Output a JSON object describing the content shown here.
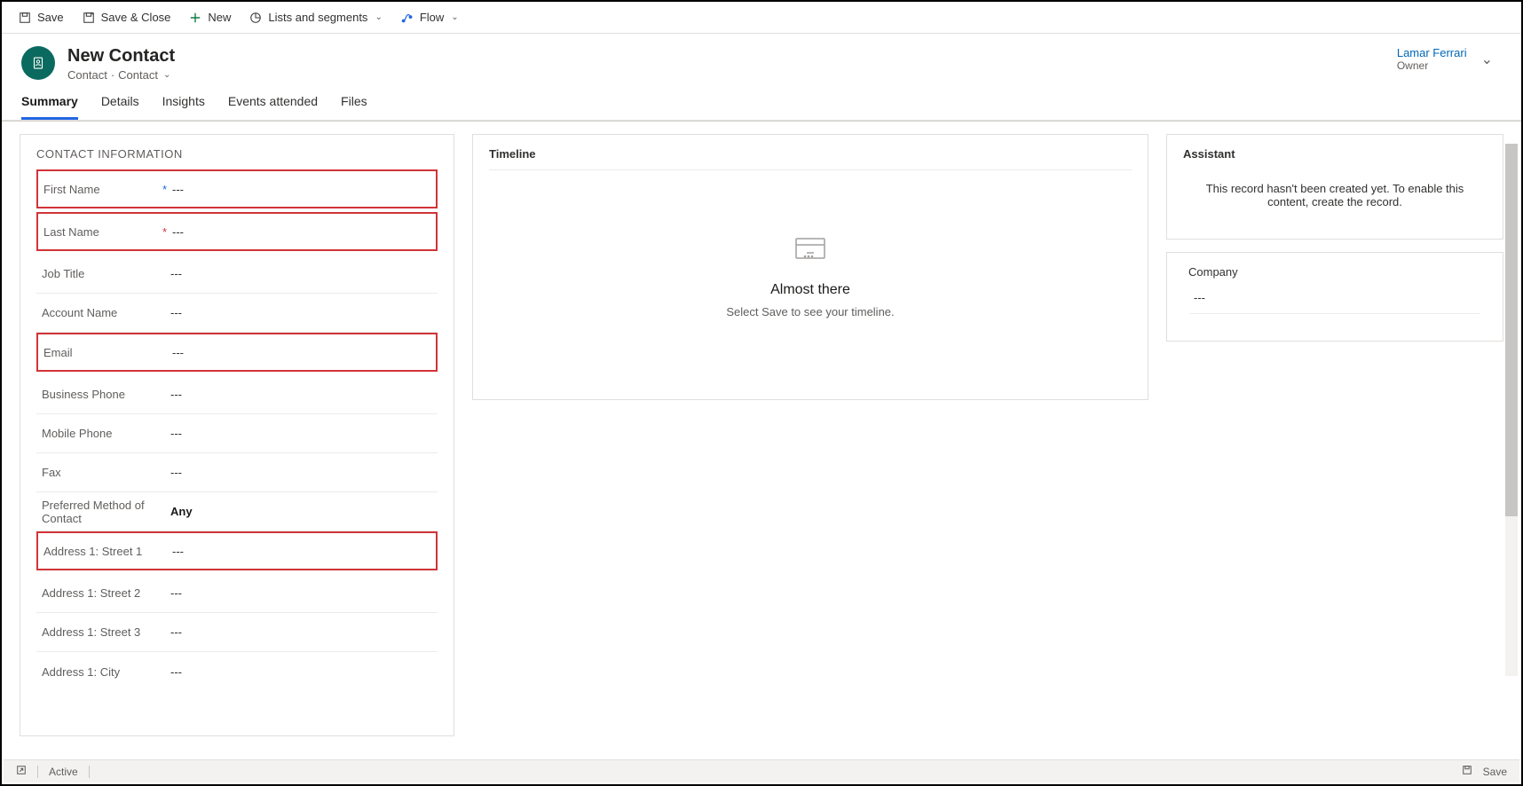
{
  "toolbar": {
    "save": "Save",
    "save_close": "Save & Close",
    "new": "New",
    "lists": "Lists and segments",
    "flow": "Flow"
  },
  "header": {
    "title": "New Contact",
    "entity": "Contact",
    "form": "Contact",
    "owner_name": "Lamar Ferrari",
    "owner_label": "Owner"
  },
  "tabs": [
    "Summary",
    "Details",
    "Insights",
    "Events attended",
    "Files"
  ],
  "contact_section_title": "CONTACT INFORMATION",
  "fields": {
    "first_name": {
      "label": "First Name",
      "value": "---"
    },
    "last_name": {
      "label": "Last Name",
      "value": "---"
    },
    "job_title": {
      "label": "Job Title",
      "value": "---"
    },
    "account_name": {
      "label": "Account Name",
      "value": "---"
    },
    "email": {
      "label": "Email",
      "value": "---"
    },
    "business_phone": {
      "label": "Business Phone",
      "value": "---"
    },
    "mobile_phone": {
      "label": "Mobile Phone",
      "value": "---"
    },
    "fax": {
      "label": "Fax",
      "value": "---"
    },
    "pref_contact": {
      "label": "Preferred Method of Contact",
      "value": "Any"
    },
    "addr1_s1": {
      "label": "Address 1: Street 1",
      "value": "---"
    },
    "addr1_s2": {
      "label": "Address 1: Street 2",
      "value": "---"
    },
    "addr1_s3": {
      "label": "Address 1: Street 3",
      "value": "---"
    },
    "addr1_city": {
      "label": "Address 1: City",
      "value": "---"
    }
  },
  "timeline": {
    "title": "Timeline",
    "heading": "Almost there",
    "message": "Select Save to see your timeline."
  },
  "assistant": {
    "title": "Assistant",
    "message": "This record hasn't been created yet. To enable this content, create the record."
  },
  "company": {
    "title": "Company",
    "value": "---"
  },
  "footer": {
    "status": "Active",
    "save": "Save"
  }
}
